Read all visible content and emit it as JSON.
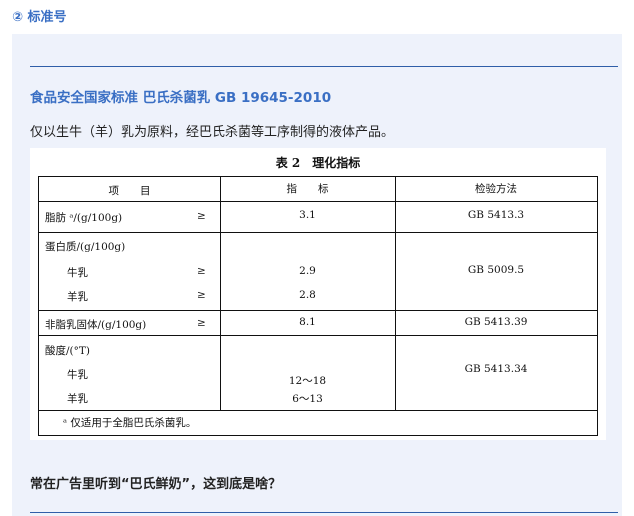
{
  "section": {
    "number": "②",
    "title": "标准号"
  },
  "doc": {
    "title": "食品安全国家标准 巴氏杀菌乳 GB 19645-2010",
    "lead": "仅以生牛（羊）乳为原料，经巴氏杀菌等工序制得的液体产品。"
  },
  "table": {
    "caption_no": "表 2",
    "caption_title": "理化指标",
    "headers": {
      "item": "项　　目",
      "index": "指　　标",
      "method": "检验方法"
    },
    "rows": {
      "fat": {
        "label": "脂肪 ᵃ/(g/100g)",
        "op": "≥",
        "value": "3.1",
        "method": "GB 5413.3"
      },
      "protein": {
        "label": "蛋白质/(g/100g)",
        "method": "GB 5009.5"
      },
      "protein_cow": {
        "label": "牛乳",
        "op": "≥",
        "value": "2.9"
      },
      "protein_goat": {
        "label": "羊乳",
        "op": "≥",
        "value": "2.8"
      },
      "snf": {
        "label": "非脂乳固体/(g/100g)",
        "op": "≥",
        "value": "8.1",
        "method": "GB 5413.39"
      },
      "acidity": {
        "label": "酸度/(°T)",
        "method": "GB 5413.34"
      },
      "acidity_cow": {
        "label": "牛乳",
        "value": "12～18"
      },
      "acidity_goat": {
        "label": "羊乳",
        "value": "6～13"
      }
    },
    "footnote": "ᵃ 仅适用于全脂巴氏杀菌乳。"
  },
  "question": "常在广告里听到“巴氏鲜奶”，这到底是啥？"
}
